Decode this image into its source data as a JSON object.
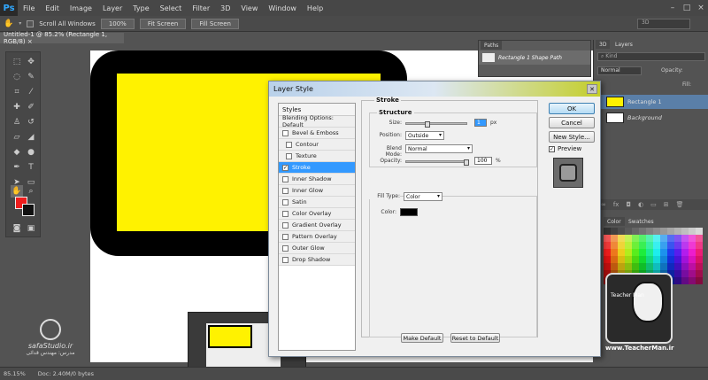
{
  "menubar": {
    "logo": "Ps",
    "items": [
      "File",
      "Edit",
      "Image",
      "Layer",
      "Type",
      "Select",
      "Filter",
      "3D",
      "View",
      "Window",
      "Help"
    ]
  },
  "options": {
    "scroll_all_windows": "Scroll All Windows",
    "zoom_100": "100%",
    "fit_screen": "Fit Screen",
    "fill_screen": "Fill Screen",
    "workspace": "3D"
  },
  "document": {
    "tab_title": "Untitled-1 @ 85.2% (Rectangle 1, RGB/8) ×"
  },
  "dialog": {
    "title": "Layer Style",
    "styles_header": "Styles",
    "styles": [
      {
        "label": "Blending Options: Default",
        "checkbox": false,
        "sub": false,
        "active": false
      },
      {
        "label": "Bevel & Emboss",
        "checkbox": true,
        "checked": false,
        "sub": false,
        "active": false
      },
      {
        "label": "Contour",
        "checkbox": true,
        "checked": false,
        "sub": true,
        "active": false
      },
      {
        "label": "Texture",
        "checkbox": true,
        "checked": false,
        "sub": true,
        "active": false
      },
      {
        "label": "Stroke",
        "checkbox": true,
        "checked": true,
        "sub": false,
        "active": true
      },
      {
        "label": "Inner Shadow",
        "checkbox": true,
        "checked": false,
        "sub": false,
        "active": false
      },
      {
        "label": "Inner Glow",
        "checkbox": true,
        "checked": false,
        "sub": false,
        "active": false
      },
      {
        "label": "Satin",
        "checkbox": true,
        "checked": false,
        "sub": false,
        "active": false
      },
      {
        "label": "Color Overlay",
        "checkbox": true,
        "checked": false,
        "sub": false,
        "active": false
      },
      {
        "label": "Gradient Overlay",
        "checkbox": true,
        "checked": false,
        "sub": false,
        "active": false
      },
      {
        "label": "Pattern Overlay",
        "checkbox": true,
        "checked": false,
        "sub": false,
        "active": false
      },
      {
        "label": "Outer Glow",
        "checkbox": true,
        "checked": false,
        "sub": false,
        "active": false
      },
      {
        "label": "Drop Shadow",
        "checkbox": true,
        "checked": false,
        "sub": false,
        "active": false
      }
    ],
    "stroke": {
      "section": "Stroke",
      "structure": "Structure",
      "size_label": "Size:",
      "size_value": "1",
      "size_unit": "px",
      "position_label": "Position:",
      "position_value": "Outside",
      "blend_label": "Blend Mode:",
      "blend_value": "Normal",
      "opacity_label": "Opacity:",
      "opacity_value": "100",
      "opacity_unit": "%",
      "fill_type_label": "Fill Type:",
      "fill_type_value": "Color",
      "color_label": "Color:",
      "make_default": "Make Default",
      "reset_default": "Reset to Default"
    },
    "buttons": {
      "ok": "OK",
      "cancel": "Cancel",
      "new_style": "New Style...",
      "preview": "Preview"
    }
  },
  "paths": {
    "tab": "Paths",
    "item": "Rectangle 1 Shape Path"
  },
  "layers": {
    "tab_3d": "3D",
    "tab_layers": "Layers",
    "kind": "Kind",
    "blend": "Normal",
    "opacity_label": "Opacity:",
    "fill_label": "Fill:",
    "items": [
      "Rectangle 1",
      "Background"
    ]
  },
  "swatches": {
    "tab_color": "Color",
    "tab_swatches": "Swatches"
  },
  "status": {
    "zoom": "85.15%",
    "doc": "Doc: 2.40M/0 bytes"
  },
  "watermark": {
    "left_brand": "safaStudio.ir",
    "left_sub": "مدرس: مهندس قدائی",
    "right_url": "www.TeacherMan.ir",
    "badge_text": "Teacher Man"
  },
  "colors": {
    "foreground": "#ee1d1d",
    "background": "#111111",
    "shape_fill": "#fff200",
    "shape_stroke": "#000000",
    "selection": "#3399ff"
  }
}
